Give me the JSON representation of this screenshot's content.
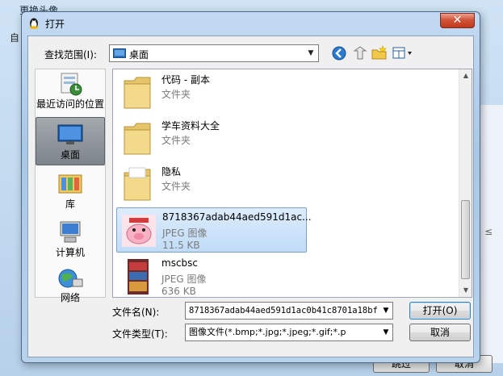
{
  "background_window": {
    "title": "更换头像",
    "label_left": "自",
    "edge_mark": "≤",
    "skip_button": "跳过",
    "cancel_button": "取消"
  },
  "dialog": {
    "title": "打开",
    "close_glyph": "✕"
  },
  "lookin": {
    "label": "查找范围(I):",
    "value": "桌面"
  },
  "places": [
    {
      "label": "最近访问的位置",
      "icon": "recent-places-icon"
    },
    {
      "label": "桌面",
      "icon": "desktop-icon",
      "selected": true
    },
    {
      "label": "库",
      "icon": "libraries-icon"
    },
    {
      "label": "计算机",
      "icon": "computer-icon"
    },
    {
      "label": "网络",
      "icon": "network-icon"
    }
  ],
  "files": [
    {
      "name": "代码 - 副本",
      "type": "文件夹",
      "size": ""
    },
    {
      "name": "学车资料大全",
      "type": "文件夹",
      "size": ""
    },
    {
      "name": "隐私",
      "type": "文件夹",
      "size": ""
    },
    {
      "name": "8718367adab44aed591d1ac...",
      "type": "JPEG 图像",
      "size": "11.5 KB",
      "selected": true
    },
    {
      "name": "mscbsc",
      "type": "JPEG 图像",
      "size": "636 KB"
    }
  ],
  "filename": {
    "label": "文件名(N):",
    "value": "8718367adab44aed591d1ac0b41c8701a18bf"
  },
  "filetype": {
    "label": "文件类型(T):",
    "value": "图像文件(*.bmp;*.jpg;*.jpeg;*.gif;*.p"
  },
  "buttons": {
    "open": "打开(O)",
    "cancel": "取消"
  },
  "colors": {
    "accent": "#3c7fb1",
    "selection": "#c1dcf8",
    "close": "#c0391c"
  }
}
